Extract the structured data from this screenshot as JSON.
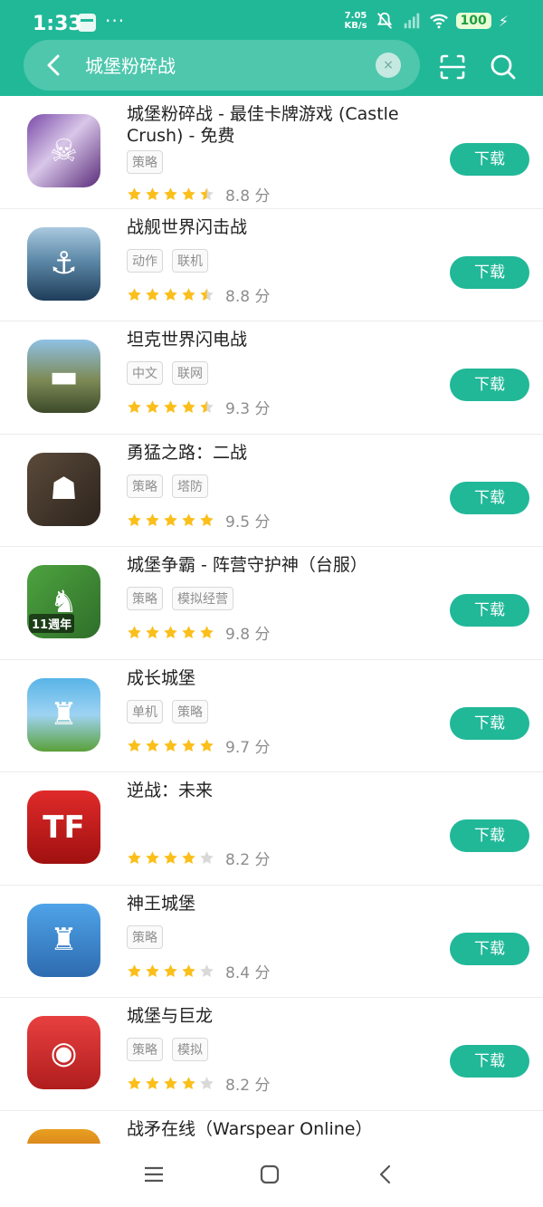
{
  "status": {
    "time": "1:33",
    "net_speed_value": "7.05",
    "net_speed_unit": "KB/s",
    "battery": "100",
    "icons": [
      "message-icon",
      "more-dots-icon",
      "mute-icon",
      "signal-icon",
      "wifi-icon",
      "battery-icon",
      "charging-icon"
    ]
  },
  "search": {
    "query": "城堡粉碎战",
    "clear_symbol": "×"
  },
  "colors": {
    "primary": "#21b898",
    "star": "#fbbf1b",
    "star_empty": "#d9d9d9"
  },
  "apps": [
    {
      "name": "城堡粉碎战 - 最佳卡牌游戏 (Castle Crush) - 免费",
      "tags": [
        "策略"
      ],
      "stars": 4.5,
      "score": "8.8 分",
      "button": "下载",
      "icon": "castle-crush-icon"
    },
    {
      "name": "战舰世界闪击战",
      "tags": [
        "动作",
        "联机"
      ],
      "stars": 4.5,
      "score": "8.8 分",
      "button": "下载",
      "icon": "warships-blitz-icon"
    },
    {
      "name": "坦克世界闪电战",
      "tags": [
        "中文",
        "联网"
      ],
      "stars": 4.5,
      "score": "9.3 分",
      "button": "下载",
      "icon": "tank-blitz-icon"
    },
    {
      "name": "勇猛之路：二战",
      "tags": [
        "策略",
        "塔防"
      ],
      "stars": 5,
      "score": "9.5 分",
      "button": "下载",
      "icon": "road-to-valor-icon"
    },
    {
      "name": "城堡争霸 - 阵营守护神（台服）",
      "tags": [
        "策略",
        "模拟经营"
      ],
      "stars": 5,
      "score": "9.8 分",
      "button": "下载",
      "icon": "castle-clash-icon",
      "badge": "11週年"
    },
    {
      "name": "成长城堡",
      "tags": [
        "单机",
        "策略"
      ],
      "stars": 5,
      "score": "9.7 分",
      "button": "下载",
      "icon": "grow-castle-icon"
    },
    {
      "name": "逆战：未来",
      "tags": [],
      "stars": 4,
      "score": "8.2 分",
      "button": "下载",
      "icon": "nizhan-future-icon"
    },
    {
      "name": "神王城堡",
      "tags": [
        "策略"
      ],
      "stars": 4,
      "score": "8.4 分",
      "button": "下载",
      "icon": "god-king-castle-icon"
    },
    {
      "name": "城堡与巨龙",
      "tags": [
        "策略",
        "模拟"
      ],
      "stars": 4,
      "score": "8.2 分",
      "button": "下载",
      "icon": "castles-dragons-icon"
    },
    {
      "name": "战矛在线（Warspear Online）",
      "tags": [],
      "stars": 0,
      "score": "",
      "button": "",
      "icon": "warspear-icon"
    }
  ],
  "nav": {
    "icons": [
      "menu-icon",
      "home-icon",
      "back-icon"
    ]
  }
}
